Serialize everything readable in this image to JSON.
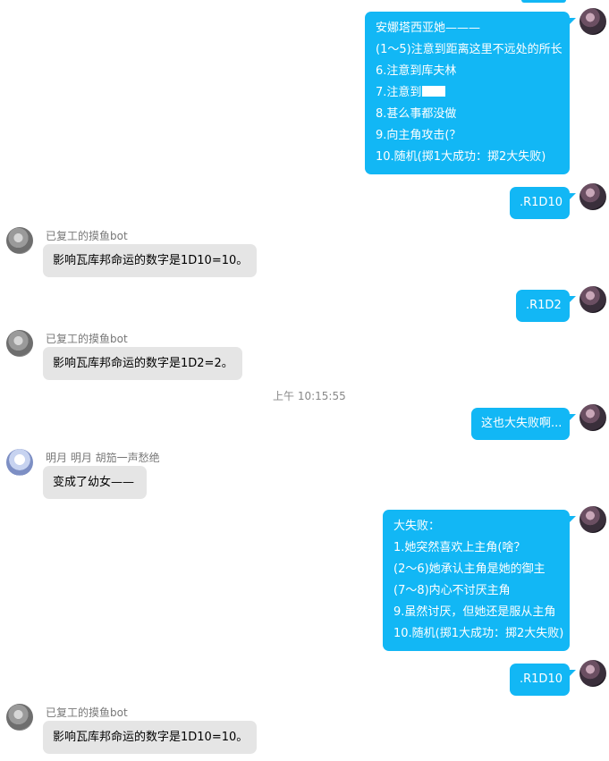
{
  "colors": {
    "outgoing_bubble": "#12b7f5",
    "incoming_bubble": "#e5e5e5",
    "sender_name": "#777777",
    "background": "#ffffff"
  },
  "messages": [
    {
      "lines": [
        "安娜塔西亚她———",
        "(1～5)注意到距离这里不远处的所长",
        "6.注意到库夫林",
        "7.注意到",
        "8.甚么事都没做",
        "9.向主角攻击(？",
        "10.随机(掷1大成功：掷2大失败)"
      ]
    },
    {
      "lines": [
        ".R1D10"
      ]
    },
    {
      "sender": "已复工的摸鱼bot",
      "text": "影响瓦库邦命运的数字是1D10=10。"
    },
    {
      "lines": [
        ".R1D2"
      ]
    },
    {
      "sender": "已复工的摸鱼bot",
      "text": "影响瓦库邦命运的数字是1D2=2。"
    },
    {
      "time": "上午 10:15:55"
    },
    {
      "lines": [
        "这也大失败啊..."
      ]
    },
    {
      "sender": "明月 明月   胡笳一声愁绝",
      "text": "变成了幼女——"
    },
    {
      "lines": [
        "大失败：",
        "1.她突然喜欢上主角(啥？",
        "(2～6)她承认主角是她的御主",
        "(7～8)内心不讨厌主角",
        "9.虽然讨厌，但她还是服从主角",
        "10.随机(掷1大成功：掷2大失败)"
      ]
    },
    {
      "lines": [
        ".R1D10"
      ]
    },
    {
      "sender": "已复工的摸鱼bot",
      "text": "影响瓦库邦命运的数字是1D10=10。"
    }
  ]
}
